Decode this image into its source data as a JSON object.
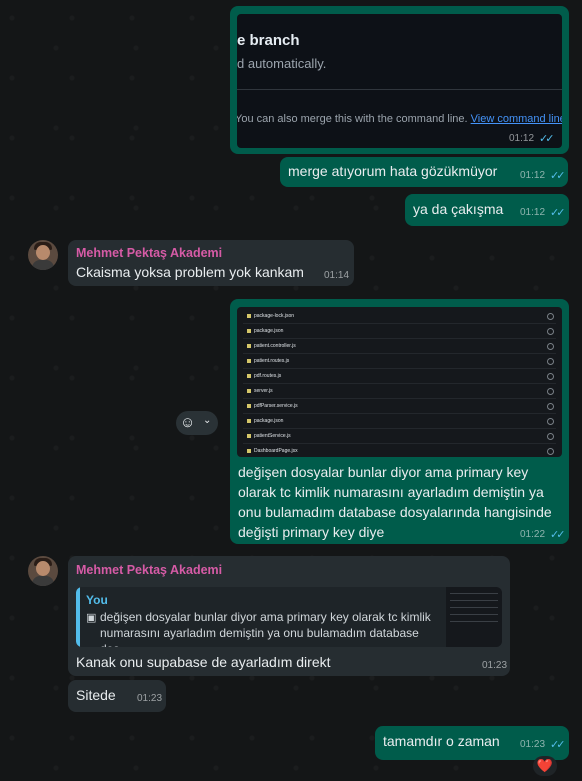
{
  "messages": {
    "m1": {
      "shot_title": "e branch",
      "shot_sub": "d automatically.",
      "shot_foot": "You can also merge this with the command line.",
      "shot_link": "View command line",
      "time": "01:12"
    },
    "m2": {
      "text": "merge atıyorum hata gözükmüyor",
      "time": "01:12"
    },
    "m3": {
      "text": "ya da çakışma",
      "time": "01:12"
    },
    "m4": {
      "sender": "Mehmet Pektaş Akademi",
      "text": "Ckaisma yoksa problem yok kankam",
      "time": "01:14"
    },
    "m5": {
      "files": [
        "package-lock.json",
        "package.json",
        "patient.controller.js",
        "patient.routes.js",
        "pdf.routes.js",
        "server.js",
        "pdfParser.service.js",
        "package.json",
        "patientService.js",
        "DashboardPage.jsx"
      ],
      "text": "değişen dosyalar bunlar diyor ama primary key olarak tc kimlik numarasını ayarladım demiştin ya onu bulamadım database dosyalarında hangisinde değişti primary key diye",
      "time": "01:22"
    },
    "m6": {
      "sender": "Mehmet Pektaş Akademi",
      "quote_author": "You",
      "quote_text": "değişen dosyalar bunlar diyor ama primary key olarak tc kimlik numarasını ayarladım demiştin ya onu bulamadım database dos...",
      "text": "Kanak onu supabase de ayarladım direkt",
      "time": "01:23"
    },
    "m7": {
      "text": "Sitede",
      "time": "01:23"
    },
    "m8": {
      "text": "tamamdır o zaman",
      "time": "01:23",
      "reaction": "❤️"
    }
  },
  "colors": {
    "outgoing": "#005c4b",
    "incoming": "#262d31",
    "sender": "#d65ba6",
    "ticks": "#53bdeb"
  }
}
